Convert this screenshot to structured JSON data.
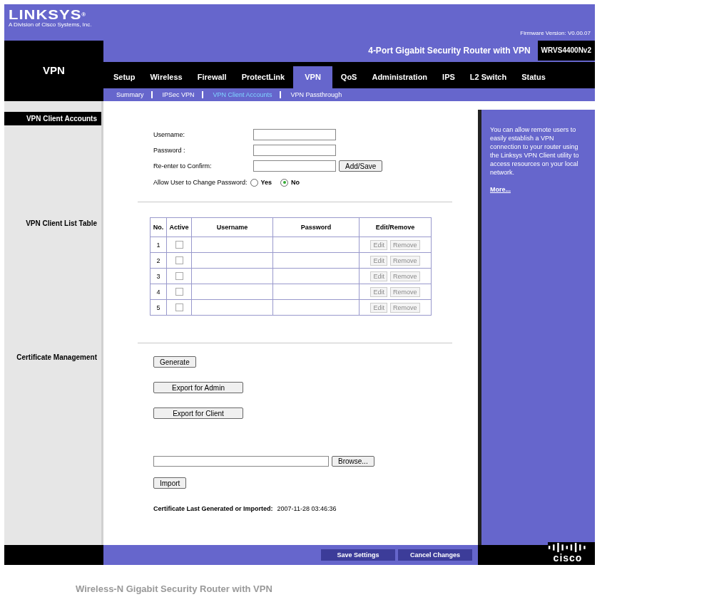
{
  "header": {
    "logo": "LINKSYS",
    "logo_mark": "®",
    "tagline": "A Division of Cisco Systems, Inc.",
    "firmware": "Firmware Version: V0.00.07"
  },
  "section_title": "VPN",
  "product_name": "4-Port Gigabit Security Router with VPN",
  "model": "WRVS4400Nv2",
  "tabs": [
    {
      "label": "Setup",
      "selected": false
    },
    {
      "label": "Wireless",
      "selected": false
    },
    {
      "label": "Firewall",
      "selected": false
    },
    {
      "label": "ProtectLink",
      "selected": false
    },
    {
      "label": "VPN",
      "selected": true
    },
    {
      "label": "QoS",
      "selected": false
    },
    {
      "label": "Administration",
      "selected": false
    },
    {
      "label": "IPS",
      "selected": false
    },
    {
      "label": "L2 Switch",
      "selected": false
    },
    {
      "label": "Status",
      "selected": false
    }
  ],
  "subtabs": [
    {
      "label": "Summary",
      "selected": false
    },
    {
      "label": "IPSec VPN",
      "selected": false
    },
    {
      "label": "VPN Client Accounts",
      "selected": true
    },
    {
      "label": "VPN Passthrough",
      "selected": false
    }
  ],
  "accounts": {
    "label": "VPN Client Accounts",
    "fields": [
      {
        "label": "Username:"
      },
      {
        "label": "Password :"
      },
      {
        "label": "Re-enter to Confirm:"
      }
    ],
    "add_button": "Add/Save",
    "change_password": {
      "label": "Allow User to Change Password:",
      "options": [
        {
          "label": "Yes",
          "selected": false
        },
        {
          "label": "No",
          "selected": true
        }
      ]
    }
  },
  "client_list": {
    "label": "VPN Client List Table",
    "columns": [
      "No.",
      "Active",
      "Username",
      "Password",
      "Edit/Remove"
    ],
    "rows": [
      {
        "no": "1",
        "active": false,
        "actions": [
          {
            "label": "Edit",
            "disabled": true
          },
          {
            "label": "Remove",
            "disabled": true
          }
        ]
      },
      {
        "no": "2",
        "active": false,
        "actions": [
          {
            "label": "Edit",
            "disabled": true
          },
          {
            "label": "Remove",
            "disabled": true
          }
        ]
      },
      {
        "no": "3",
        "active": false,
        "actions": [
          {
            "label": "Edit",
            "disabled": true
          },
          {
            "label": "Remove",
            "disabled": true
          }
        ]
      },
      {
        "no": "4",
        "active": false,
        "actions": [
          {
            "label": "Edit",
            "disabled": true
          },
          {
            "label": "Remove",
            "disabled": true
          }
        ]
      },
      {
        "no": "5",
        "active": false,
        "actions": [
          {
            "label": "Edit",
            "disabled": true
          },
          {
            "label": "Remove",
            "disabled": true
          }
        ]
      }
    ]
  },
  "certificate": {
    "label": "Certificate Management",
    "buttons": [
      "Generate",
      "Export for Admin",
      "Export for Client"
    ],
    "browse_button": "Browse...",
    "import_button": "Import",
    "last_label": "Certificate Last Generated or Imported:",
    "last_value": "2007-11-28 03:46:36"
  },
  "help": {
    "text": "You can allow remote users to easily establish a VPN connection to your router using the Linksys VPN Client utility to access resources on your local network.",
    "link": "More..."
  },
  "footer": {
    "buttons": [
      "Save Settings",
      "Cancel Changes"
    ],
    "brand": "cisco"
  },
  "caption": "Wireless-N Gigabit Security Router with VPN"
}
